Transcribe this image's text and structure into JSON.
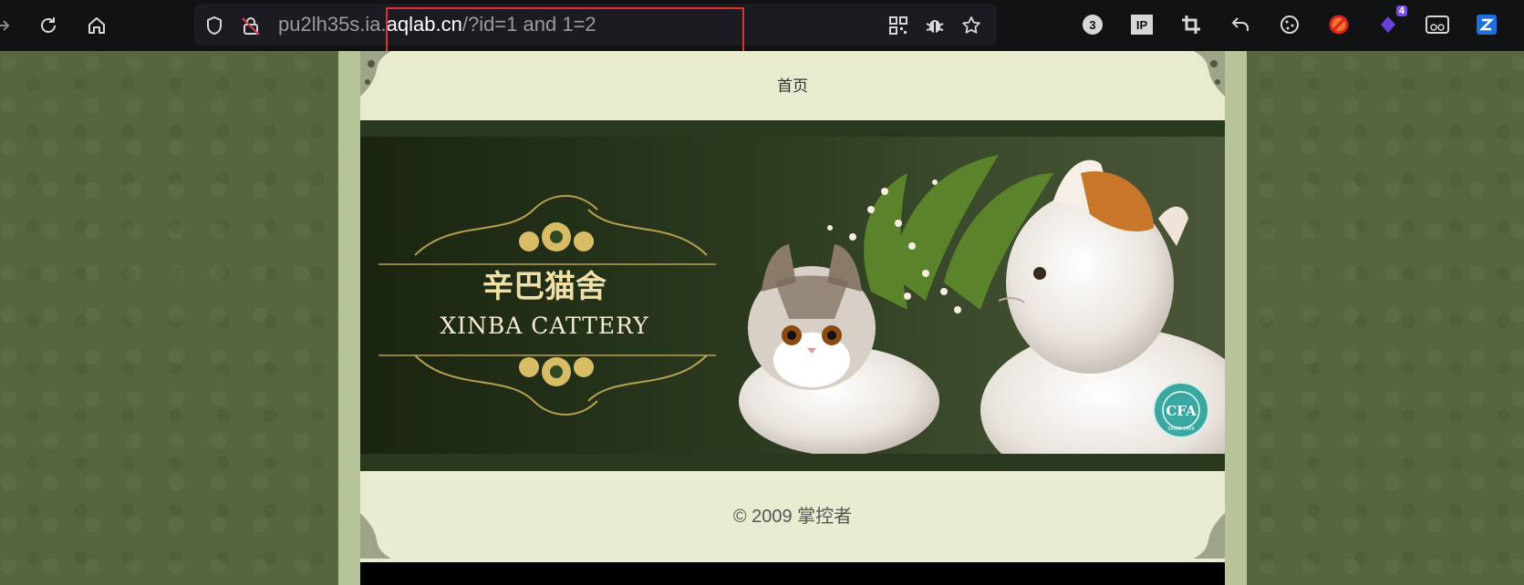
{
  "browser": {
    "url_prefix": "pu2lh35s.ia.",
    "url_domain": "aqlab.cn",
    "url_path": "/?id=1 and 1=2",
    "extension_badges": {
      "counter": "3",
      "notifications": "4",
      "ip": "IP"
    }
  },
  "page": {
    "nav": {
      "home_link": "首页"
    },
    "banner": {
      "title_cn": "辛巴猫舍",
      "title_en": "XINBA  CATTERY",
      "seal_text": "CFA",
      "seal_subtext": "SINCE 1906"
    },
    "footer": {
      "copyright": "© 2009 掌控者"
    }
  },
  "colors": {
    "highlight": "#e03030",
    "page_background": "#56663f",
    "banner_gold": "#e6cf7a"
  }
}
